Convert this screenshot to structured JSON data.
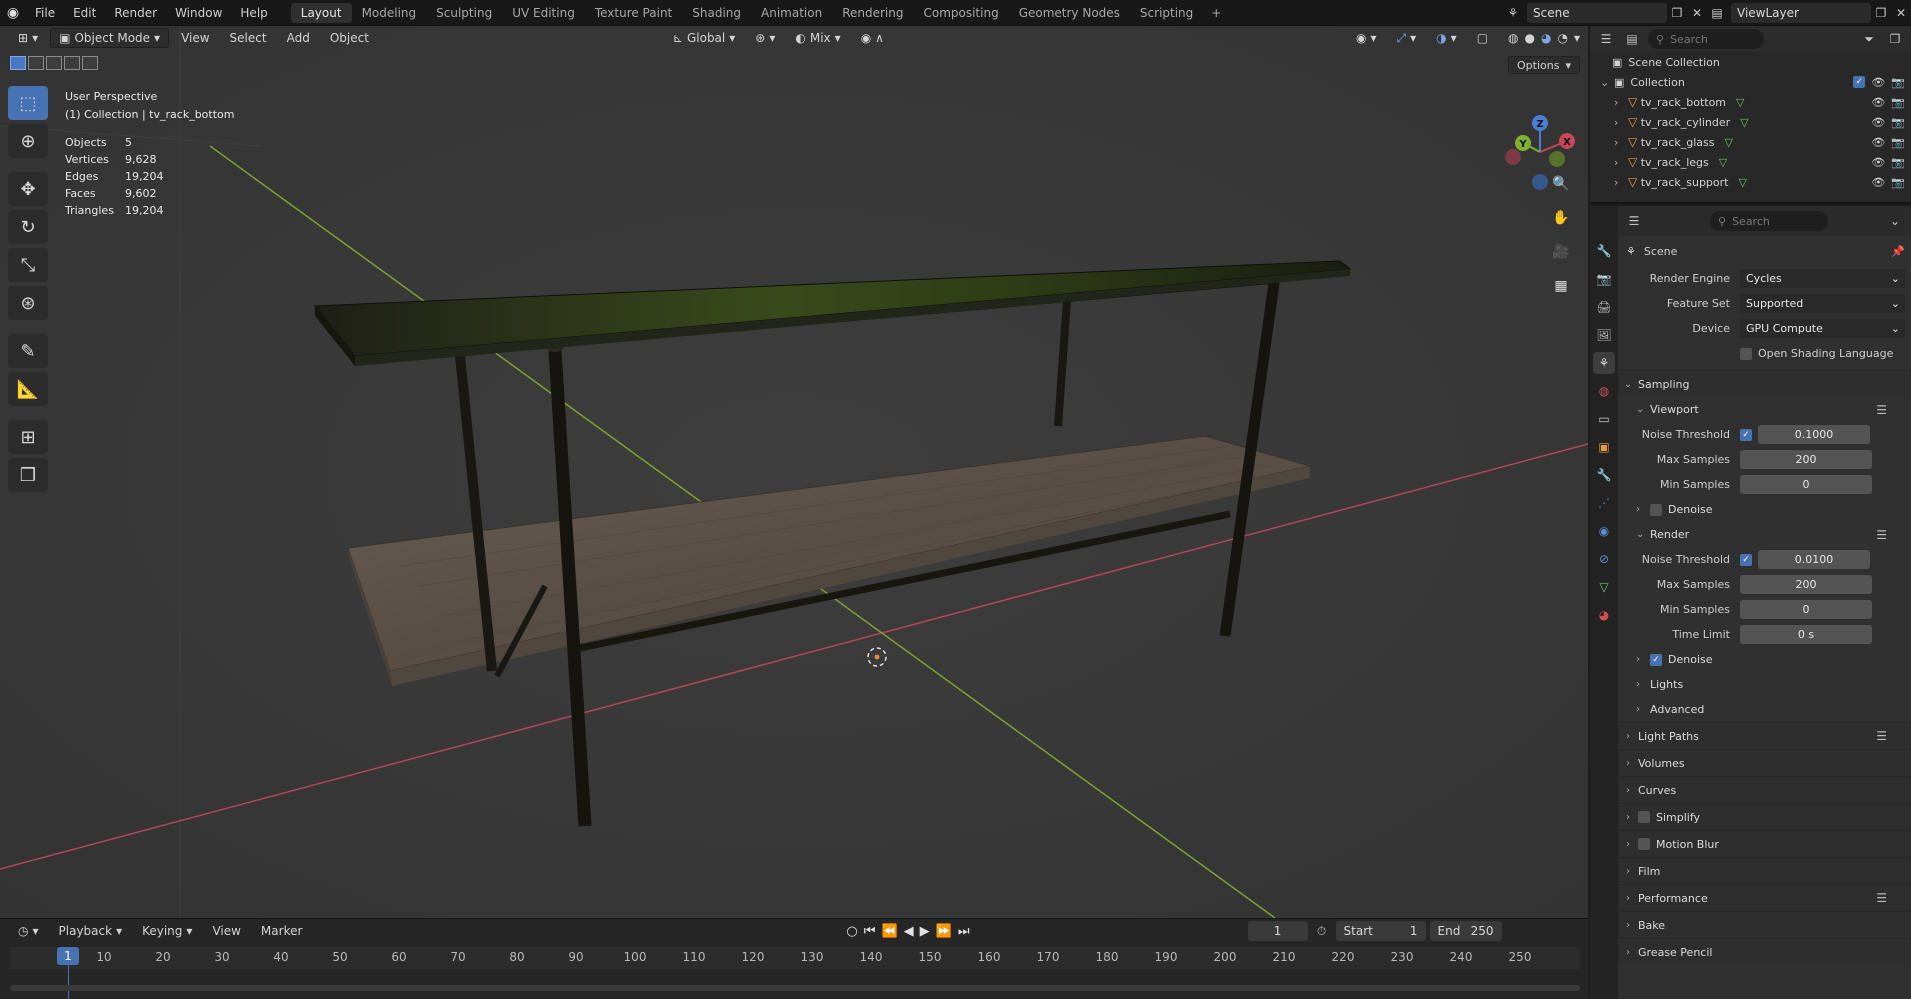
{
  "topbar": {
    "menus": [
      "File",
      "Edit",
      "Render",
      "Window",
      "Help"
    ],
    "workspaces": [
      "Layout",
      "Modeling",
      "Sculpting",
      "UV Editing",
      "Texture Paint",
      "Shading",
      "Animation",
      "Rendering",
      "Compositing",
      "Geometry Nodes",
      "Scripting"
    ],
    "active_workspace": "Layout",
    "scene_name": "Scene",
    "view_layer": "ViewLayer"
  },
  "viewport": {
    "mode": "Object Mode",
    "menus": [
      "View",
      "Select",
      "Add",
      "Object"
    ],
    "transform_orientation": "Global",
    "snap_mode": "Mix",
    "options_label": "Options",
    "view_name": "User Perspective",
    "collection_label": "(1) Collection | tv_rack_bottom",
    "stats": [
      {
        "label": "Objects",
        "value": "5"
      },
      {
        "label": "Vertices",
        "value": "9,628"
      },
      {
        "label": "Edges",
        "value": "19,204"
      },
      {
        "label": "Faces",
        "value": "9,602"
      },
      {
        "label": "Triangles",
        "value": "19,204"
      }
    ],
    "axis_labels": {
      "x": "X",
      "y": "Y",
      "z": "Z"
    }
  },
  "timeline": {
    "menus": [
      "Playback",
      "Keying",
      "View",
      "Marker"
    ],
    "current_frame": "1",
    "start_label": "Start",
    "start": "1",
    "end_label": "End",
    "end": "250",
    "ticks": [
      "1",
      "10",
      "20",
      "30",
      "40",
      "50",
      "60",
      "70",
      "80",
      "90",
      "100",
      "110",
      "120",
      "130",
      "140",
      "150",
      "160",
      "170",
      "180",
      "190",
      "200",
      "210",
      "220",
      "230",
      "240",
      "250"
    ]
  },
  "outliner": {
    "search_placeholder": "Search",
    "root": "Scene Collection",
    "collection": "Collection",
    "objects": [
      "tv_rack_bottom",
      "tv_rack_cylinder",
      "tv_rack_glass",
      "tv_rack_legs",
      "tv_rack_support"
    ]
  },
  "properties": {
    "search_placeholder": "Search",
    "context": "Scene",
    "render_engine_label": "Render Engine",
    "render_engine": "Cycles",
    "feature_set_label": "Feature Set",
    "feature_set": "Supported",
    "device_label": "Device",
    "device": "GPU Compute",
    "osl_label": "Open Shading Language",
    "sampling": {
      "title": "Sampling",
      "viewport": {
        "title": "Viewport",
        "noise_threshold_label": "Noise Threshold",
        "noise_threshold": "0.1000",
        "max_samples_label": "Max Samples",
        "max_samples": "200",
        "min_samples_label": "Min Samples",
        "min_samples": "0",
        "denoise_label": "Denoise"
      },
      "render": {
        "title": "Render",
        "noise_threshold_label": "Noise Threshold",
        "noise_threshold": "0.0100",
        "max_samples_label": "Max Samples",
        "max_samples": "200",
        "min_samples_label": "Min Samples",
        "min_samples": "0",
        "time_limit_label": "Time Limit",
        "time_limit": "0 s",
        "denoise_label": "Denoise"
      },
      "lights": "Lights",
      "advanced": "Advanced"
    },
    "panels": [
      "Light Paths",
      "Volumes",
      "Curves",
      "Simplify",
      "Motion Blur",
      "Film",
      "Performance",
      "Bake",
      "Grease Pencil"
    ]
  },
  "colors": {
    "accent": "#4772b3",
    "x_axis": "#b5455a",
    "y_axis": "#7ea12f",
    "mesh_icon": "#e89a3c"
  }
}
